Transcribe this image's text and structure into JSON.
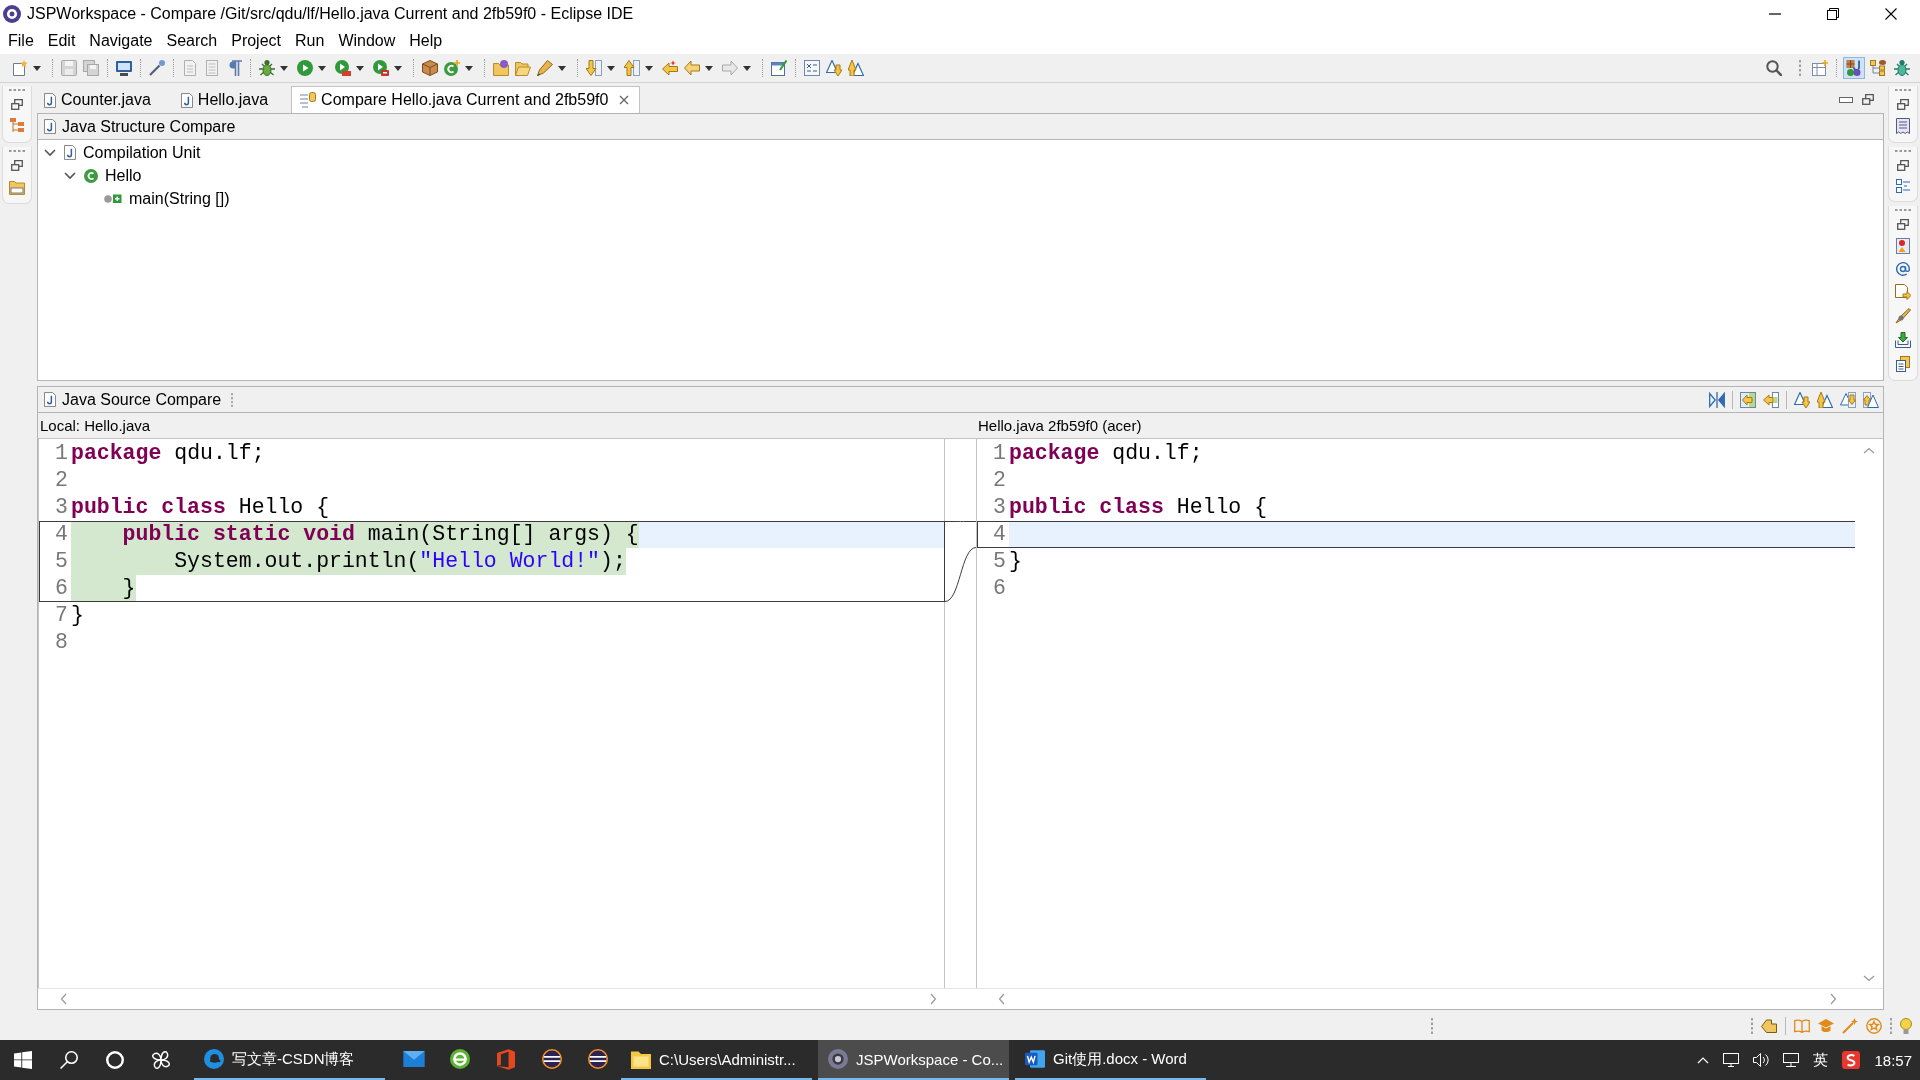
{
  "window": {
    "title": "JSPWorkspace - Compare /Git/src/qdu/lf/Hello.java Current and 2fb59f0 - Eclipse IDE"
  },
  "menu": [
    "File",
    "Edit",
    "Navigate",
    "Search",
    "Project",
    "Run",
    "Window",
    "Help"
  ],
  "perspectives": [
    {
      "kind": "java-ee",
      "selected": true
    },
    {
      "kind": "beans",
      "selected": false
    },
    {
      "kind": "debug",
      "selected": false
    }
  ],
  "editor_tabs": [
    {
      "kind": "java",
      "label": "Counter.java",
      "selected": false
    },
    {
      "kind": "java",
      "label": "Hello.java",
      "selected": false
    },
    {
      "kind": "compare",
      "label": "Compare Hello.java Current and 2fb59f0",
      "selected": true
    }
  ],
  "structure_compare": {
    "title": "Java Structure Compare",
    "tree": [
      {
        "kind": "unit",
        "label": "Compilation Unit",
        "expanded": true,
        "children": [
          {
            "kind": "class",
            "label": "Hello",
            "expanded": true,
            "children": [
              {
                "kind": "method",
                "label": "main(String [])"
              }
            ]
          }
        ]
      }
    ]
  },
  "source_compare": {
    "title": "Java Source Compare",
    "panes": [
      {
        "header": "Local: Hello.java",
        "lines": [
          {
            "number": "1",
            "changed": false,
            "current": false,
            "tokens": [
              {
                "kind": "keyword",
                "text": "package"
              },
              {
                "kind": "plain",
                "text": " qdu.lf;"
              }
            ]
          },
          {
            "number": "2",
            "changed": false,
            "current": false
          },
          {
            "number": "3",
            "changed": false,
            "current": false,
            "tokens": [
              {
                "kind": "keyword",
                "text": "public class"
              },
              {
                "kind": "plain",
                "text": " Hello {"
              }
            ]
          },
          {
            "number": "4",
            "changed": true,
            "current": true,
            "tokens": [
              {
                "kind": "keyword",
                "text": "    public static void"
              },
              {
                "kind": "plain",
                "text": " main(String[] args) {"
              }
            ]
          },
          {
            "number": "5",
            "changed": true,
            "current": false,
            "tokens": [
              {
                "kind": "plain",
                "text": "        System.out.println("
              },
              {
                "kind": "string",
                "text": "\"Hello World!\""
              },
              {
                "kind": "plain",
                "text": ");"
              }
            ]
          },
          {
            "number": "6",
            "changed": true,
            "current": false,
            "tokens": [
              {
                "kind": "plain",
                "text": "    }"
              }
            ]
          },
          {
            "number": "7",
            "changed": false,
            "current": false,
            "tokens": [
              {
                "kind": "plain",
                "text": "}"
              }
            ]
          },
          {
            "number": "8",
            "changed": false,
            "current": false
          }
        ]
      },
      {
        "header": "Hello.java 2fb59f0 (acer)",
        "lines": [
          {
            "number": "1",
            "changed": false,
            "current": false,
            "tokens": [
              {
                "kind": "keyword",
                "text": "package"
              },
              {
                "kind": "plain",
                "text": " qdu.lf;"
              }
            ]
          },
          {
            "number": "2",
            "changed": false,
            "current": false
          },
          {
            "number": "3",
            "changed": false,
            "current": false,
            "tokens": [
              {
                "kind": "keyword",
                "text": "public class"
              },
              {
                "kind": "plain",
                "text": " Hello {"
              }
            ]
          },
          {
            "number": "4",
            "changed": true,
            "current": true
          },
          {
            "number": "5",
            "changed": false,
            "current": false,
            "tokens": [
              {
                "kind": "plain",
                "text": "}"
              }
            ]
          },
          {
            "number": "6",
            "changed": false,
            "current": false
          }
        ]
      }
    ]
  },
  "taskbar": {
    "items": [
      {
        "kind": "browser",
        "label": "写文章-CSDN博客",
        "selected": false
      },
      {
        "kind": "mail",
        "selected": false
      },
      {
        "kind": "globe",
        "selected": false
      },
      {
        "kind": "office",
        "selected": false
      },
      {
        "kind": "eclipse",
        "selected": false
      },
      {
        "kind": "eclipse",
        "selected": false
      },
      {
        "kind": "folder",
        "label": "C:\\Users\\Administr...",
        "selected": false
      },
      {
        "kind": "workspace",
        "label": "JSPWorkspace - Co...",
        "selected": true
      },
      {
        "kind": "word",
        "label": "Git使用.docx - Word",
        "selected": false
      }
    ],
    "tray": {
      "input_method": "英",
      "clock": "18:57"
    }
  }
}
